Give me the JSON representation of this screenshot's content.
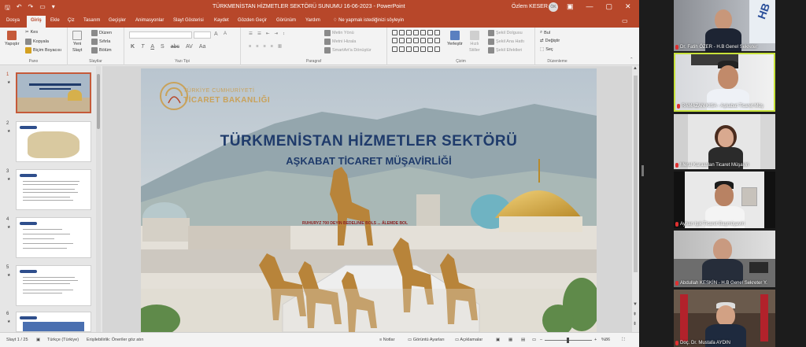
{
  "titlebar": {
    "document_title": "TÜRKMENİSTAN HİZMETLER SEKTÖRÜ SUNUMU 16-06-2023  -  PowerPoint",
    "user_name": "Özlem KESER",
    "user_initials": "ÖK",
    "minimize": "—",
    "maximize": "▢",
    "close": "✕"
  },
  "tabs": [
    {
      "label": "Dosya"
    },
    {
      "label": "Giriş",
      "active": true
    },
    {
      "label": "Ekle"
    },
    {
      "label": "Çiz"
    },
    {
      "label": "Tasarım"
    },
    {
      "label": "Geçişler"
    },
    {
      "label": "Animasyonlar"
    },
    {
      "label": "Slayt Gösterisi"
    },
    {
      "label": "Kaydet"
    },
    {
      "label": "Gözden Geçir"
    },
    {
      "label": "Görünüm"
    },
    {
      "label": "Yardım"
    }
  ],
  "tell_me": "Ne yapmak istediğinizi söyleyin",
  "ribbon": {
    "pano": {
      "label": "Pano",
      "paste": "Yapıştır",
      "cut": "Kes",
      "copy": "Kopyala",
      "format_painter": "Biçim Boyacısı"
    },
    "slides": {
      "label": "Slaytlar",
      "new_slide_1": "Yeni",
      "new_slide_2": "Slayt",
      "layout": "Düzen",
      "reset": "Sıfırla",
      "section": "Bölüm"
    },
    "font": {
      "label": "Yazı Tipi",
      "bold": "K",
      "italic": "T",
      "underline": "A",
      "strike": "S",
      "shadow": "abc",
      "spacing": "AV",
      "case": "Aa"
    },
    "paragraph": {
      "label": "Paragraf",
      "text_direction": "Metin Yönü",
      "align_text": "Metni Hizala",
      "smartart": "SmartArt'a Dönüştür"
    },
    "drawing": {
      "label": "Çizim",
      "arrange": "Yerleştir",
      "quick_styles_1": "Hızlı",
      "quick_styles_2": "Stiller",
      "shape_fill": "Şekil Dolgusu",
      "shape_outline": "Şekil Ana Hattı",
      "shape_effects": "Şekil Efektleri"
    },
    "editing": {
      "label": "Düzenleme",
      "find": "Bul",
      "replace": "Değiştir",
      "select": "Seç"
    }
  },
  "thumbnails": [
    {
      "num": "1",
      "selected": true
    },
    {
      "num": "2",
      "selected": false
    },
    {
      "num": "3",
      "selected": false
    },
    {
      "num": "4",
      "selected": false
    },
    {
      "num": "5",
      "selected": false
    },
    {
      "num": "6",
      "selected": false
    }
  ],
  "slide": {
    "logo_line1": "TÜRKİYE CUMHURİYETİ",
    "logo_line2": "TİCARET BAKANLIĞI",
    "title": "TÜRKMENİSTAN HİZMETLER SEKTÖRÜ",
    "subtitle": "AŞKABAT TİCARET MÜŞAVİRLİĞİ",
    "sign": "RUHURYZ 700 DEYIN BEDELINIE BOLS ... ÄLEMDE BOL"
  },
  "status": {
    "slide_count": "Slayt 1 / 25",
    "language": "Türkçe (Türkiye)",
    "accessibility": "Erişilebilirlik: Öneriler göz atın",
    "notes": "Notlar",
    "display_settings": "Görüntü Ayarları",
    "comments": "Açıklamalar",
    "zoom": "%86"
  },
  "participants": [
    {
      "name": "Dr. Fatih ÖZER - H.B Genel Sekreter",
      "muted": true
    },
    {
      "name": "RAMAZAN KISA - Aşkabat Ticaret Müş",
      "muted": true,
      "active": true
    },
    {
      "name": "Meral Karaaslan Ticaret Müşaviri",
      "muted": true
    },
    {
      "name": "Ayhan Işık Ticaret Başmüşaviri",
      "muted": true
    },
    {
      "name": "Abdullah KESKİN - H.B Genel Sekreter Y.",
      "muted": true
    },
    {
      "name": "Doç. Dr. Mustafa AYDIN",
      "muted": true
    }
  ],
  "colors": {
    "accent": "#b7472a",
    "active_speaker": "#c7e23a",
    "slide_title": "#1f3b6b"
  }
}
